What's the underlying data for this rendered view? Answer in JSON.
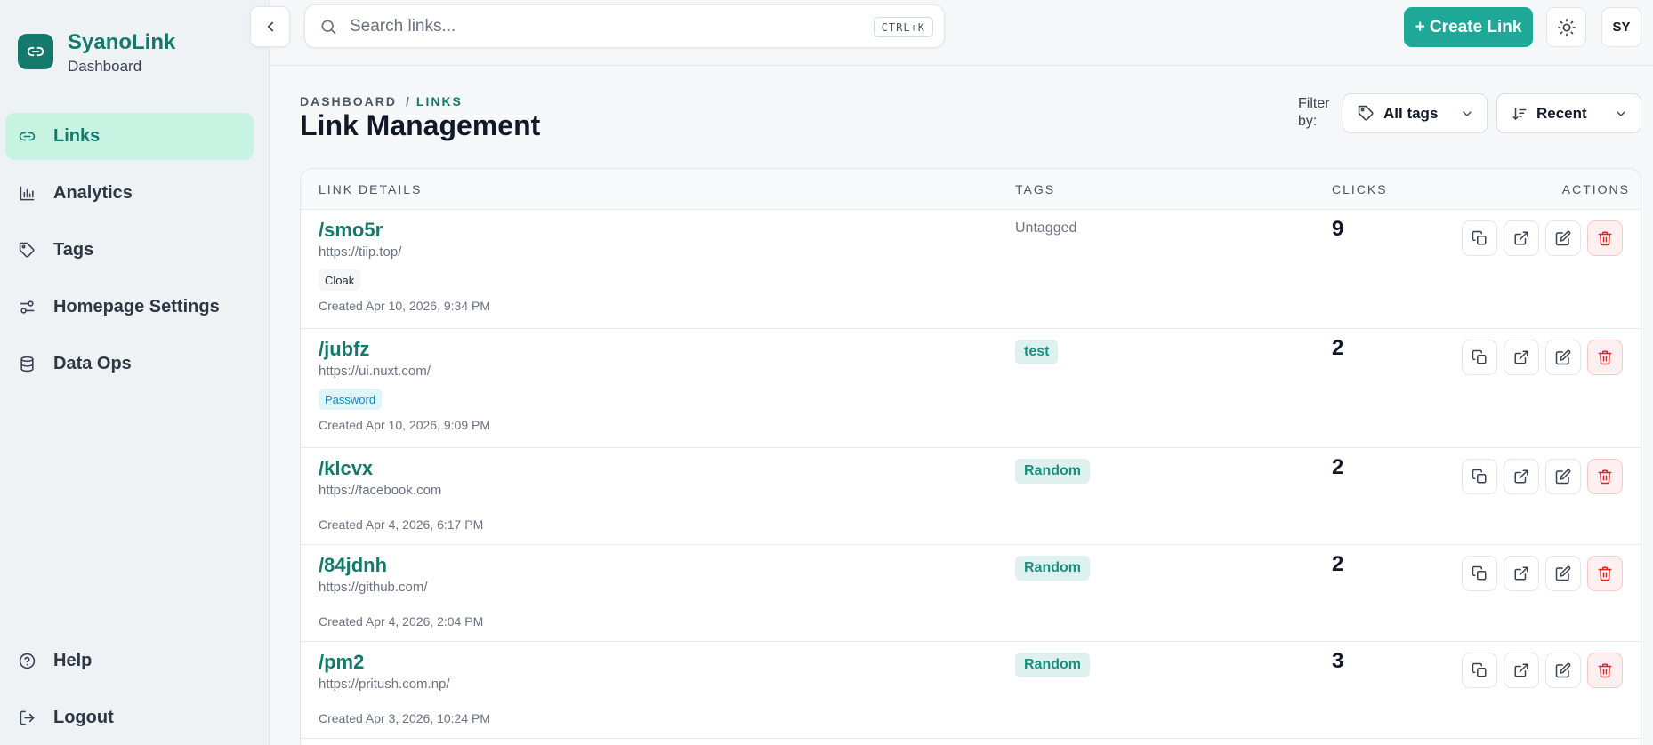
{
  "brand": {
    "name": "SyanoLink",
    "subtitle": "Dashboard"
  },
  "sidebar": {
    "items": [
      {
        "label": "Links",
        "icon": "link-icon",
        "active": true
      },
      {
        "label": "Analytics",
        "icon": "bar-chart-icon",
        "active": false
      },
      {
        "label": "Tags",
        "icon": "tag-icon",
        "active": false
      },
      {
        "label": "Homepage Settings",
        "icon": "sliders-icon",
        "active": false
      },
      {
        "label": "Data Ops",
        "icon": "database-icon",
        "active": false
      }
    ],
    "bottom": [
      {
        "label": "Help",
        "icon": "help-circle-icon"
      },
      {
        "label": "Logout",
        "icon": "logout-icon"
      }
    ]
  },
  "topbar": {
    "search_placeholder": "Search links...",
    "shortcut": "CTRL+K",
    "create_label": "+ Create Link",
    "avatar_initials": "SY"
  },
  "header": {
    "breadcrumb_root": "DASHBOARD",
    "breadcrumb_sep": "/",
    "breadcrumb_current": "LINKS",
    "title": "Link Management",
    "filter_label": "Filter by:",
    "tags_filter": "All tags",
    "sort_filter": "Recent"
  },
  "table": {
    "columns": [
      "LINK DETAILS",
      "TAGS",
      "CLICKS",
      "ACTIONS"
    ],
    "rows": [
      {
        "slug": "/smo5r",
        "url": "https://tiip.top/",
        "badge": "Cloak",
        "badge_type": "cloak",
        "created": "Created Apr 10, 2026, 9:34 PM",
        "tag": "Untagged",
        "tagged": false,
        "clicks": "9"
      },
      {
        "slug": "/jubfz",
        "url": "https://ui.nuxt.com/",
        "badge": "Password",
        "badge_type": "password",
        "created": "Created Apr 10, 2026, 9:09 PM",
        "tag": "test",
        "tagged": true,
        "clicks": "2"
      },
      {
        "slug": "/klcvx",
        "url": "https://facebook.com",
        "badge": "",
        "badge_type": "",
        "created": "Created Apr 4, 2026, 6:17 PM",
        "tag": "Random",
        "tagged": true,
        "clicks": "2"
      },
      {
        "slug": "/84jdnh",
        "url": "https://github.com/",
        "badge": "",
        "badge_type": "",
        "created": "Created Apr 4, 2026, 2:04 PM",
        "tag": "Random",
        "tagged": true,
        "clicks": "2"
      },
      {
        "slug": "/pm2",
        "url": "https://pritush.com.np/",
        "badge": "",
        "badge_type": "",
        "created": "Created Apr 3, 2026, 10:24 PM",
        "tag": "Random",
        "tagged": true,
        "clicks": "3"
      }
    ]
  },
  "colors": {
    "accent": "#14796b",
    "button": "#1fa898",
    "active_nav": "#c6f3e2",
    "danger": "#dc2626"
  }
}
